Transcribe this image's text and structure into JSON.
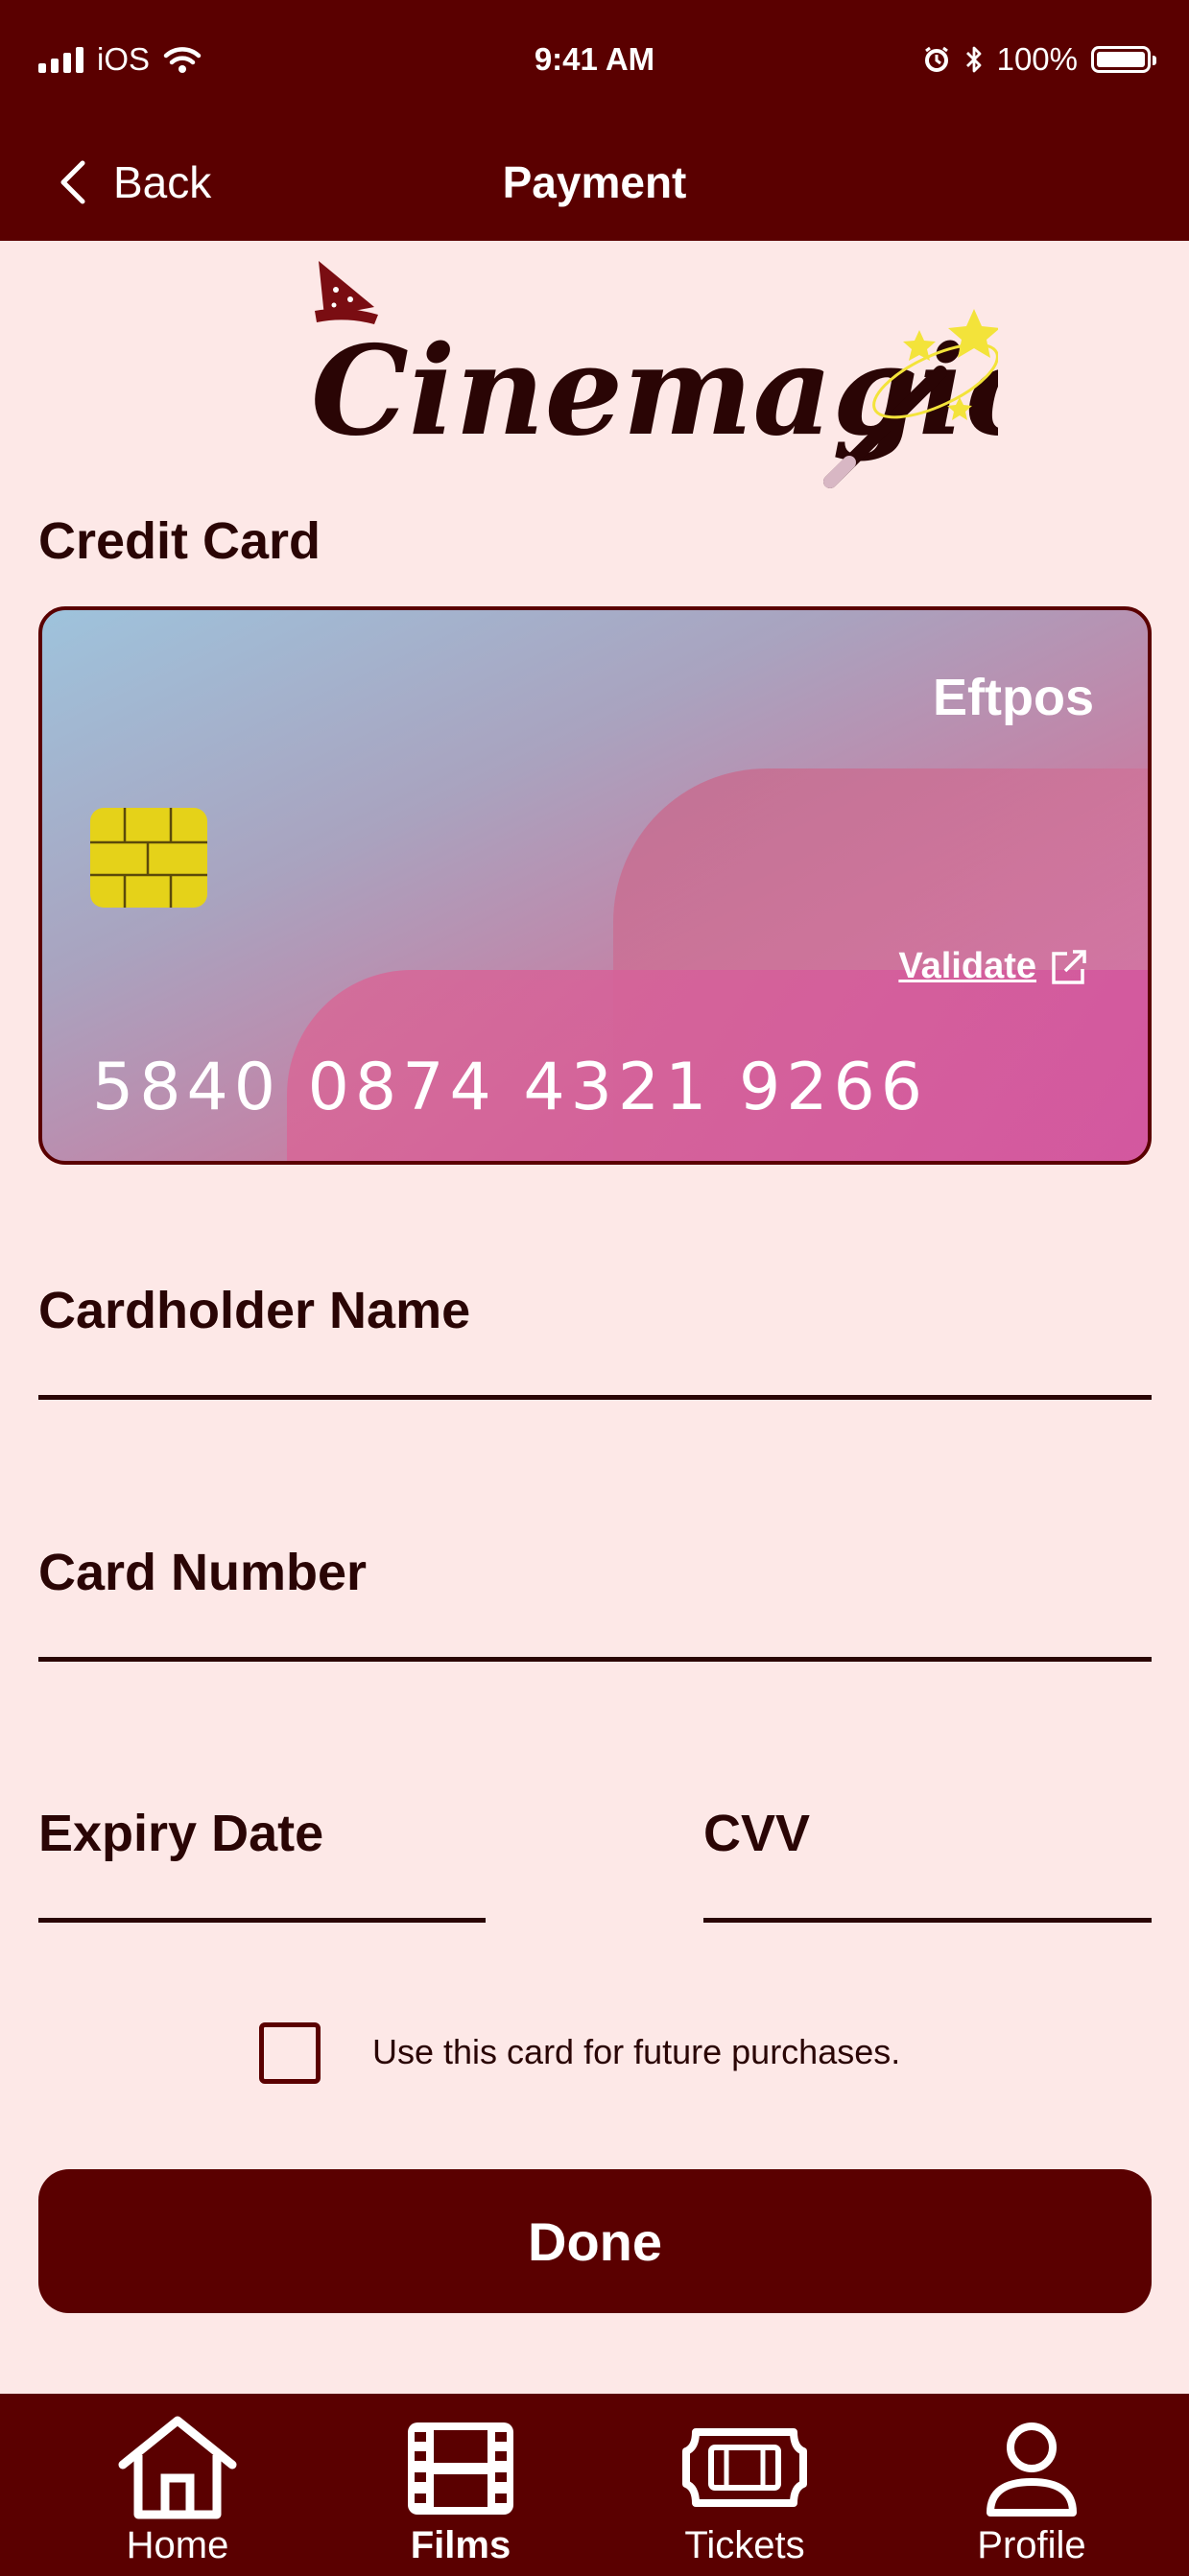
{
  "status_bar": {
    "carrier": "iOS",
    "time": "9:41 AM",
    "battery": "100%"
  },
  "nav": {
    "back_label": "Back",
    "title": "Payment"
  },
  "brand": {
    "logo_text": "Cinemagic"
  },
  "section": {
    "credit_card_title": "Credit Card"
  },
  "card": {
    "brand": "Eftpos",
    "validate_label": "Validate",
    "number": "5840 0874 4321 9266"
  },
  "form": {
    "cardholder_name_label": "Cardholder Name",
    "card_number_label": "Card Number",
    "expiry_date_label": "Expiry Date",
    "cvv_label": "CVV",
    "save_card_label": "Use this card for future purchases."
  },
  "actions": {
    "done_label": "Done"
  },
  "tabbar": {
    "items": [
      {
        "label": "Home",
        "icon": "home-icon",
        "active": false
      },
      {
        "label": "Films",
        "icon": "film-icon",
        "active": true
      },
      {
        "label": "Tickets",
        "icon": "ticket-icon",
        "active": false
      },
      {
        "label": "Profile",
        "icon": "profile-icon",
        "active": false
      }
    ]
  },
  "colors": {
    "primary": "#5a0000",
    "background": "#fde8e7",
    "chip": "#e5d219"
  }
}
